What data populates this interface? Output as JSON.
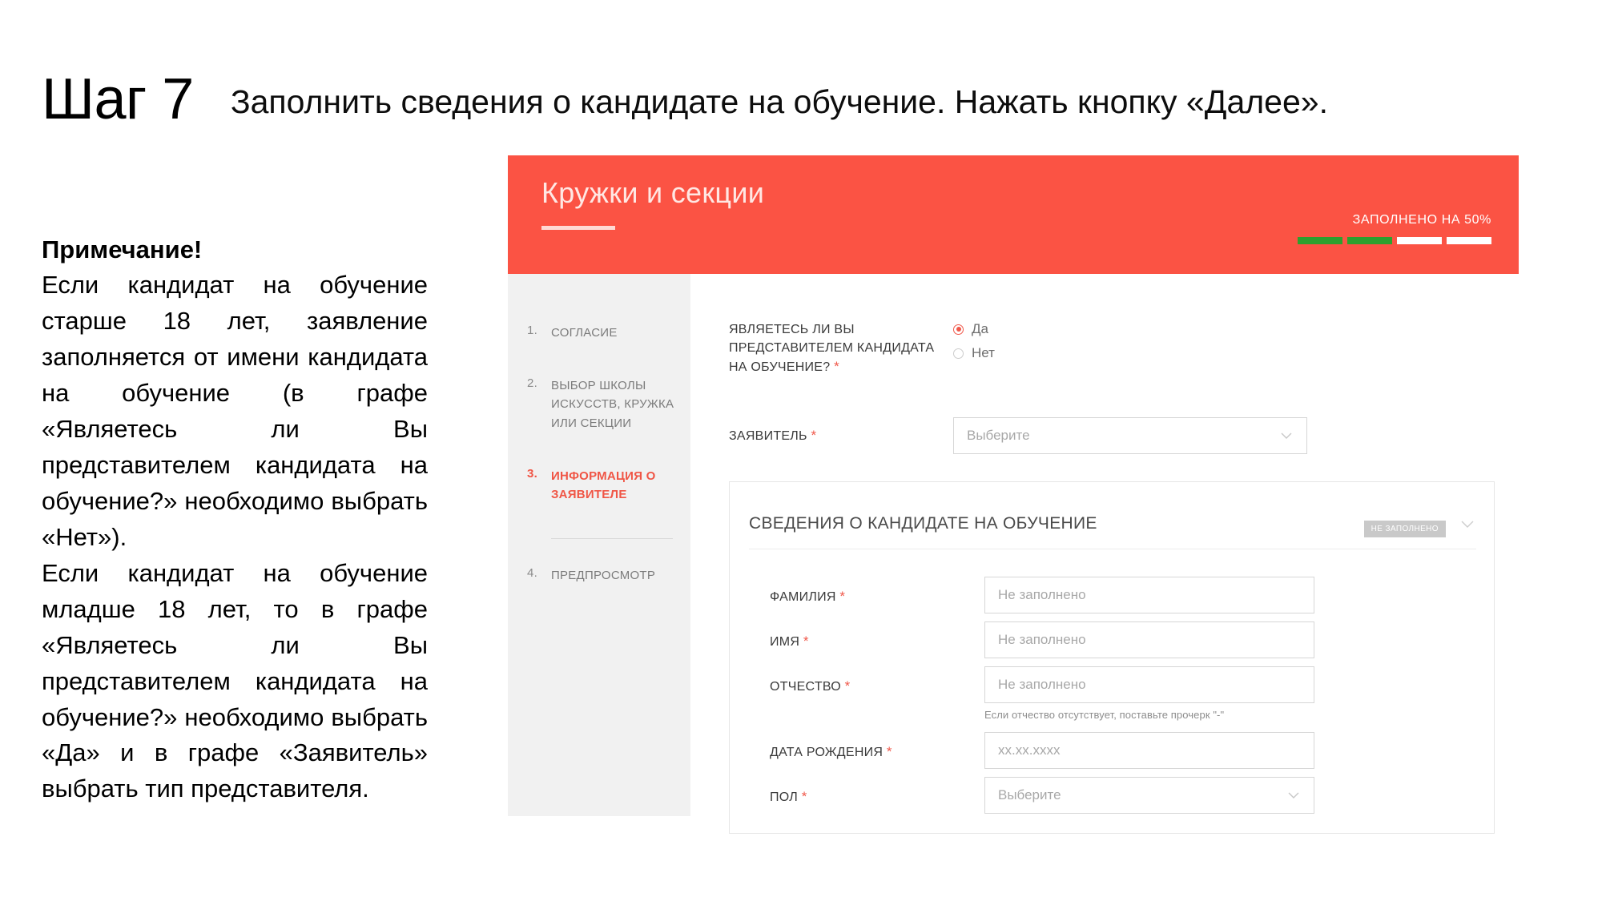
{
  "slide": {
    "step_label": "Шаг 7",
    "instruction": "Заполнить сведения о кандидате на обучение. Нажать кнопку «Далее».",
    "note_title": "Примечание!",
    "note_paragraph_1": "Если кандидат на обучение старше 18 лет, заявление заполняется от имени кандидата на обучение (в графе «Являетесь ли Вы представителем кандидата на обучение?» необходимо выбрать «Нет»).",
    "note_paragraph_2": "Если кандидат на обучение младше 18 лет, то в графе «Являетесь ли Вы представителем кандидата на обучение?» необходимо выбрать «Да» и в графе «Заявитель» выбрать тип представителя."
  },
  "app": {
    "header": {
      "title": "Кружки и секции",
      "progress_label": "ЗАПОЛНЕНО НА 50%",
      "progress_percent": 50,
      "progress_segments_total": 4,
      "progress_segments_done": 2,
      "accent_color": "#fb5344",
      "progress_done_color": "#2ea02e"
    },
    "sidebar": {
      "steps": [
        {
          "num": "1.",
          "label": "СОГЛАСИЕ",
          "active": false
        },
        {
          "num": "2.",
          "label": "ВЫБОР ШКОЛЫ ИСКУССТВ, КРУЖКА ИЛИ СЕКЦИИ",
          "active": false
        },
        {
          "num": "3.",
          "label": "ИНФОРМАЦИЯ О ЗАЯВИТЕЛЕ",
          "active": true
        },
        {
          "num": "4.",
          "label": "ПРЕДПРОСМОТР",
          "active": false
        }
      ],
      "active_color": "#f05545"
    },
    "form": {
      "representative_question": {
        "label": "ЯВЛЯЕТЕСЬ ЛИ ВЫ ПРЕДСТАВИТЕЛЕМ КАНДИДАТА НА ОБУЧЕНИЕ?",
        "required_mark": "*",
        "options": [
          {
            "label": "Да",
            "selected": true
          },
          {
            "label": "Нет",
            "selected": false
          }
        ]
      },
      "applicant": {
        "label": "ЗАЯВИТЕЛЬ",
        "required_mark": "*",
        "value": "Выберите"
      },
      "candidate_card": {
        "title": "СВЕДЕНИЯ О КАНДИДАТЕ НА ОБУЧЕНИЕ",
        "badge": "НЕ ЗАПОЛНЕНО",
        "fields": [
          {
            "label": "ФАМИЛИЯ",
            "required_mark": "*",
            "value": "Не заполнено",
            "type": "text",
            "hint": ""
          },
          {
            "label": "ИМЯ",
            "required_mark": "*",
            "value": "Не заполнено",
            "type": "text",
            "hint": ""
          },
          {
            "label": "ОТЧЕСТВО",
            "required_mark": "*",
            "value": "Не заполнено",
            "type": "text",
            "hint": "Если отчество отсутствует, поставьте прочерк \"-\""
          },
          {
            "label": "ДАТА РОЖДЕНИЯ",
            "required_mark": "*",
            "value": "xx.xx.xxxx",
            "type": "text",
            "hint": ""
          },
          {
            "label": "ПОЛ",
            "required_mark": "*",
            "value": "Выберите",
            "type": "select",
            "hint": ""
          }
        ]
      }
    }
  }
}
